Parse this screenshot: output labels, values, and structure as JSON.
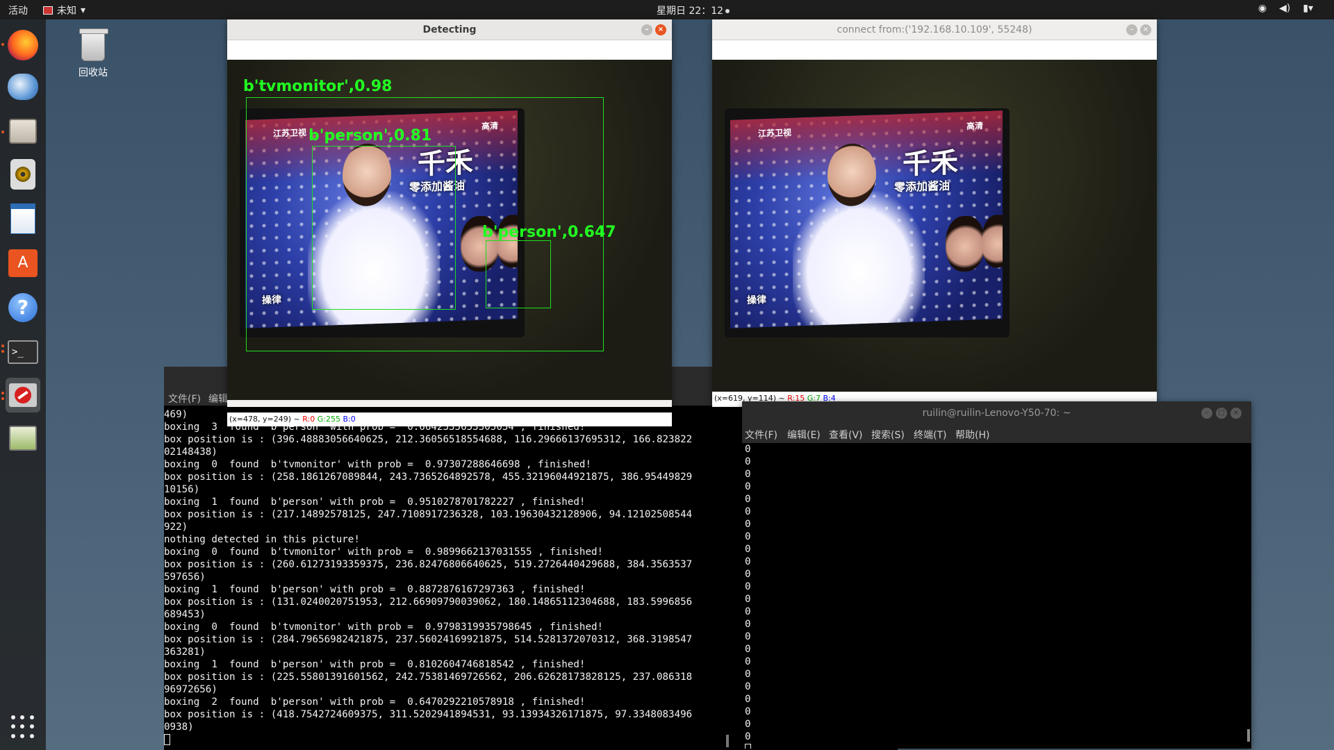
{
  "topbar": {
    "activities": "活动",
    "app_name": "未知",
    "clock": "星期日 22：12",
    "tray_icons": [
      "wifi-icon",
      "volume-icon",
      "battery-icon",
      "menu-arrow-icon"
    ]
  },
  "dock": {
    "items": [
      {
        "name": "firefox",
        "icon": "firefox-icon"
      },
      {
        "name": "thunderbird",
        "icon": "mail-icon"
      },
      {
        "name": "files",
        "icon": "files-icon"
      },
      {
        "name": "rhythmbox",
        "icon": "music-icon"
      },
      {
        "name": "writer",
        "icon": "document-icon"
      },
      {
        "name": "software",
        "icon": "store-icon"
      },
      {
        "name": "help",
        "icon": "help-icon"
      },
      {
        "name": "terminal",
        "icon": "terminal-icon"
      },
      {
        "name": "blocked-app",
        "icon": "no-entry-icon"
      },
      {
        "name": "image-viewer",
        "icon": "image-viewer-icon"
      }
    ],
    "show_apps": "apps-grid-icon"
  },
  "desktop": {
    "trash_label": "回收站"
  },
  "detect_window": {
    "title": "Detecting",
    "status": {
      "prefix": "(x=478, y=249) ~ ",
      "r": "R:0",
      "g": "G:255",
      "b": "B:0"
    },
    "detections": [
      {
        "label": "b'tvmonitor',0.98",
        "class": "tvmonitor",
        "prob": 0.98
      },
      {
        "label": "b'person',0.81",
        "class": "person",
        "prob": 0.81
      },
      {
        "label": "b'person',0.647",
        "class": "person",
        "prob": 0.647
      }
    ],
    "overlay_text": {
      "channel": "江苏卫视",
      "hd": "高清",
      "title_big": "千禾",
      "subtitle": "零添加酱油",
      "corner": "操律"
    }
  },
  "connect_window": {
    "title": "connect from:('192.168.10.109', 55248)",
    "status": {
      "prefix": "(x=619, y=114) ~ ",
      "r": "R:15",
      "g": "G:7",
      "b": "B:4"
    }
  },
  "terminal_left": {
    "menu": [
      "文件(F)",
      "编辑"
    ],
    "lines": [
      "469)",
      "boxing  3  found  b'person' with prob =  0.6642335653305054 , finished!",
      "box position is : (396.48883056640625, 212.36056518554688, 116.29666137695312, 166.823822",
      "02148438)",
      "boxing  0  found  b'tvmonitor' with prob =  0.97307288646698 , finished!",
      "box position is : (258.1861267089844, 243.7365264892578, 455.32196044921875, 386.95449829",
      "10156)",
      "boxing  1  found  b'person' with prob =  0.9510278701782227 , finished!",
      "box position is : (217.14892578125, 247.7108917236328, 103.19630432128906, 94.12102508544",
      "922)",
      "nothing detected in this picture!",
      "boxing  0  found  b'tvmonitor' with prob =  0.9899662137031555 , finished!",
      "box position is : (260.61273193359375, 236.82476806640625, 519.2726440429688, 384.3563537",
      "597656)",
      "boxing  1  found  b'person' with prob =  0.8872876167297363 , finished!",
      "box position is : (131.0240020751953, 212.66909790039062, 180.14865112304688, 183.5996856",
      "689453)",
      "boxing  0  found  b'tvmonitor' with prob =  0.9798319935798645 , finished!",
      "box position is : (284.79656982421875, 237.56024169921875, 514.5281372070312, 368.3198547",
      "363281)",
      "boxing  1  found  b'person' with prob =  0.8102604746818542 , finished!",
      "box position is : (225.55801391601562, 242.75381469726562, 206.62628173828125, 237.086318",
      "96972656)",
      "boxing  2  found  b'person' with prob =  0.6470292210578918 , finished!",
      "box position is : (418.7542724609375, 311.5202941894531, 93.13934326171875, 97.3348083496",
      "0938)"
    ]
  },
  "terminal_right": {
    "title": "ruilin@ruilin-Lenovo-Y50-70: ~",
    "menu": [
      "文件(F)",
      "编辑(E)",
      "查看(V)",
      "搜索(S)",
      "终端(T)",
      "帮助(H)"
    ],
    "lines": [
      "0",
      "0",
      "0",
      "0",
      "0",
      "0",
      "0",
      "0",
      "0",
      "0",
      "0",
      "0",
      "0",
      "0",
      "0",
      "0",
      "0",
      "0",
      "0",
      "0",
      "0",
      "0",
      "0",
      "0"
    ]
  }
}
